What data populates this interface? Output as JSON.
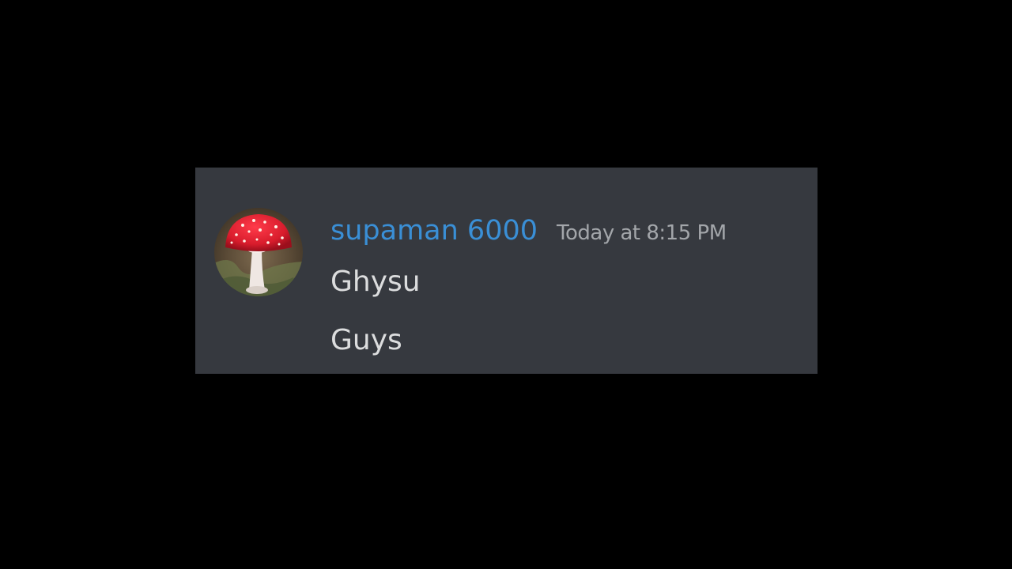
{
  "message": {
    "username": "supaman 6000",
    "timestamp": "Today at 8:15 PM",
    "lines": [
      "Ghysu",
      "Guys"
    ],
    "avatar_icon": "mushroom-avatar-icon"
  },
  "colors": {
    "page_background": "#000000",
    "card_background": "#36393f",
    "username": "#3a8fd6",
    "timestamp": "#a3a6aa",
    "message_text": "#dcddde"
  }
}
